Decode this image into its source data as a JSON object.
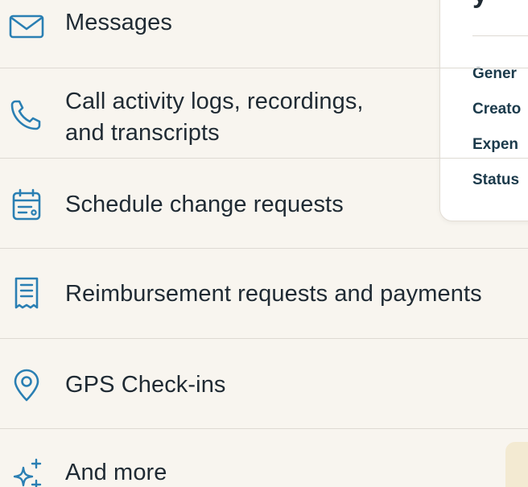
{
  "features": [
    {
      "id": "messages",
      "label_lines": [
        "Messages"
      ],
      "icon": "envelope-icon"
    },
    {
      "id": "calls",
      "label_lines": [
        "Call activity logs, recordings,",
        "and transcripts"
      ],
      "icon": "phone-icon"
    },
    {
      "id": "schedule",
      "label_lines": [
        "Schedule change requests"
      ],
      "icon": "calendar-icon"
    },
    {
      "id": "reimbursement",
      "label_lines": [
        "Reimbursement requests and payments"
      ],
      "icon": "receipt-icon"
    },
    {
      "id": "gps",
      "label_lines": [
        "GPS Check-ins"
      ],
      "icon": "location-pin-icon"
    },
    {
      "id": "more",
      "label_lines": [
        "And more"
      ],
      "icon": "sparkles-icon"
    }
  ],
  "card": {
    "heading": "y",
    "fields": [
      "Gener",
      "Creato",
      "Expen",
      "Status"
    ]
  },
  "colors": {
    "background": "#f8f5ef",
    "icon": "#2a7fb3",
    "text": "#1f2a33",
    "card_field": "#1b3a4b",
    "divider": "#dedad3",
    "promo": "#f3ead2"
  }
}
